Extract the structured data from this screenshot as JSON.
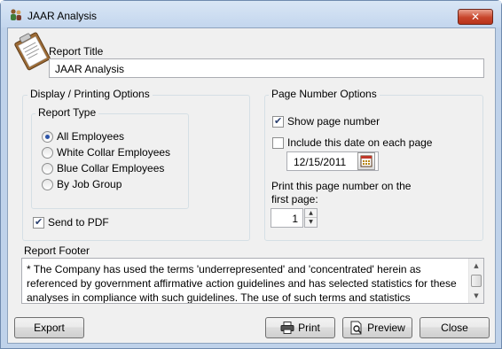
{
  "window": {
    "title": "JAAR Analysis",
    "close_glyph": "✕"
  },
  "report_title": {
    "label": "Report Title",
    "value": "JAAR Analysis"
  },
  "display_options": {
    "label": "Display / Printing Options",
    "report_type": {
      "label": "Report Type",
      "options": [
        {
          "label": "All Employees",
          "selected": true
        },
        {
          "label": "White Collar Employees",
          "selected": false
        },
        {
          "label": "Blue Collar Employees",
          "selected": false
        },
        {
          "label": "By Job Group",
          "selected": false
        }
      ]
    },
    "send_to_pdf": {
      "label": "Send to PDF",
      "checked": true
    }
  },
  "page_number_options": {
    "label": "Page Number Options",
    "show_page_number": {
      "label": "Show page number",
      "checked": true
    },
    "include_date": {
      "label": "Include this date on each page",
      "checked": false
    },
    "date_value": "12/15/2011",
    "start_page_label_line1": "Print this page number on the",
    "start_page_label_line2": "first page:",
    "start_page_value": "1"
  },
  "report_footer": {
    "label": "Report Footer",
    "text": "* The Company has used the terms 'underrepresented' and 'concentrated' herein as referenced by government affirmative action guidelines and has selected statistics for these analyses in compliance with such guidelines. The use of such terms and statistics"
  },
  "buttons": {
    "export": "Export",
    "print": "Print",
    "preview": "Preview",
    "close": "Close"
  },
  "icons": {
    "app": "people-icon",
    "clipboard": "clipboard-icon",
    "calendar": "calendar-icon",
    "print": "printer-icon",
    "preview": "preview-icon"
  },
  "colors": {
    "window_frame": "#bfd2ea",
    "client_bg": "#f0f0f0",
    "close_button": "#c8452b",
    "radio_dot": "#2c54a8"
  }
}
